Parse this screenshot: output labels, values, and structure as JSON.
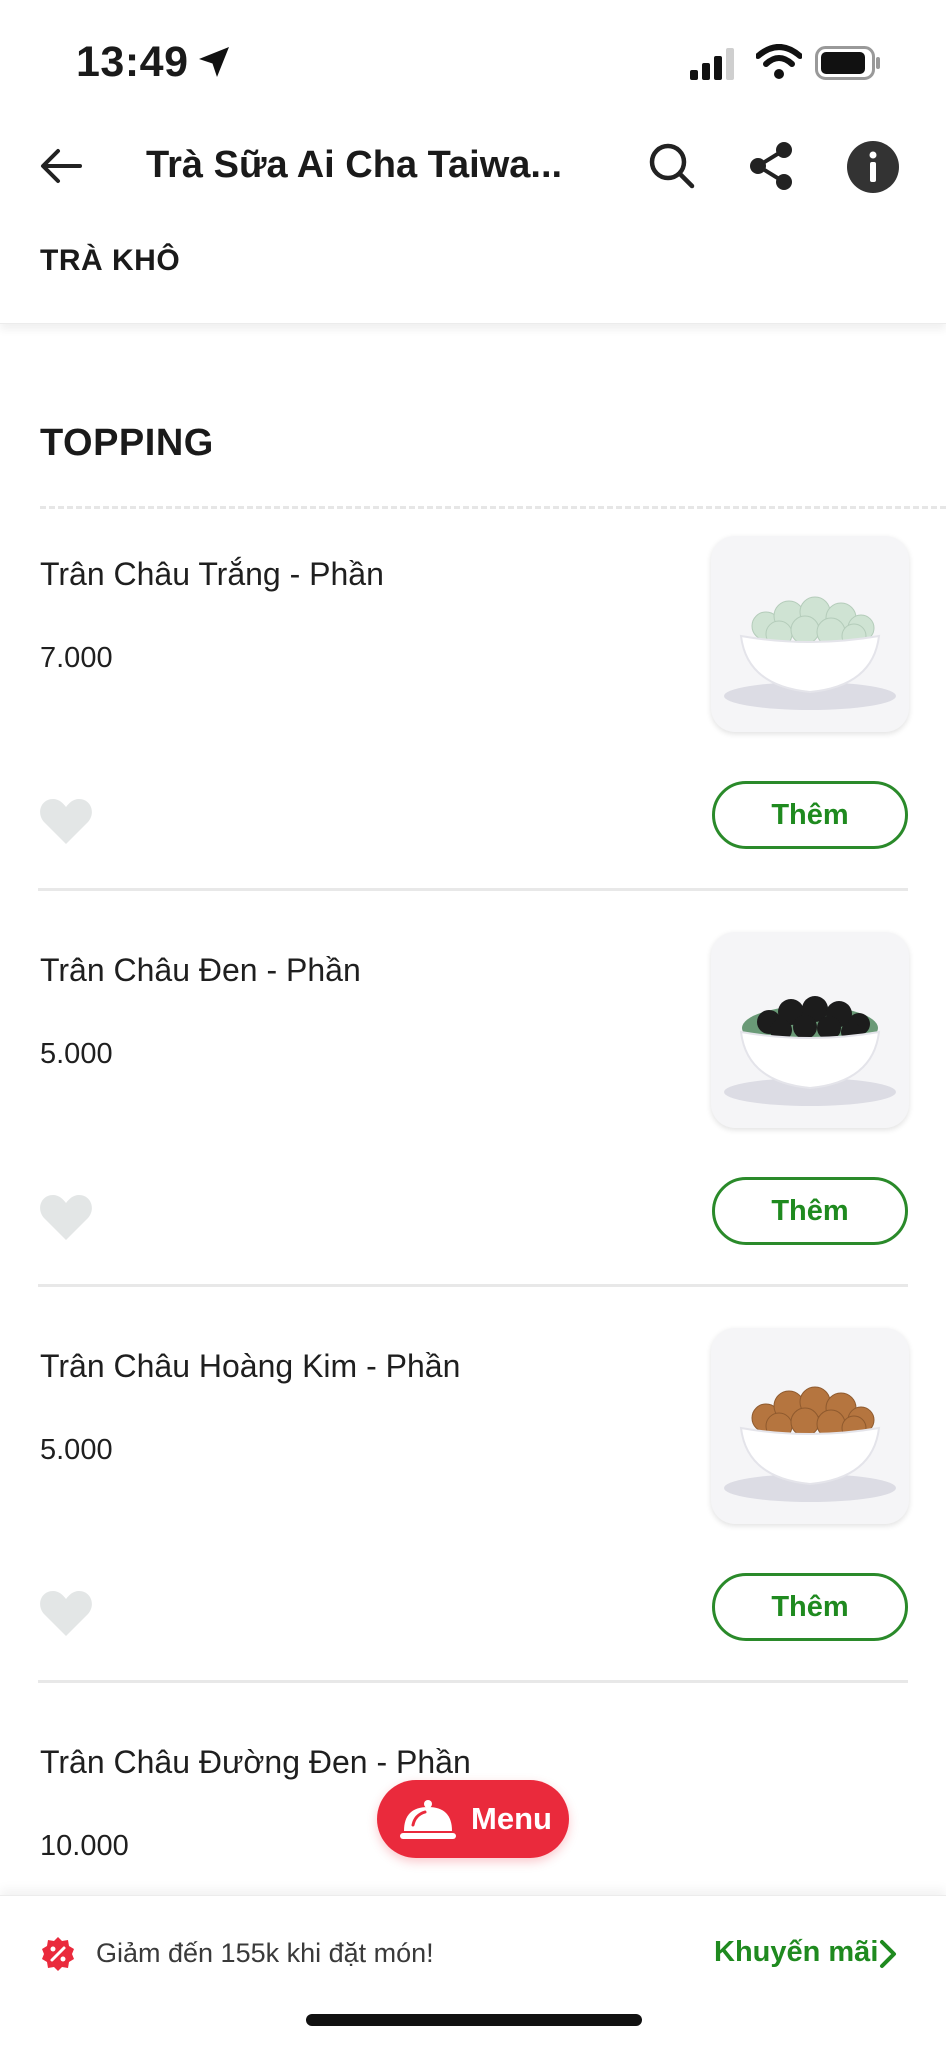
{
  "status_bar": {
    "time": "13:49"
  },
  "header": {
    "title": "Trà Sữa Ai Cha Taiwa...",
    "category_tab": "TRÀ KHÔ"
  },
  "section": {
    "title": "TOPPING"
  },
  "items": [
    {
      "name": "Trân Châu Trắng - Phần",
      "price": "7.000",
      "add_label": "Thêm",
      "pearl_color": "#cfe3d3"
    },
    {
      "name": "Trân Châu Đen - Phần",
      "price": "5.000",
      "add_label": "Thêm",
      "pearl_color": "#1c1c1c"
    },
    {
      "name": "Trân Châu Hoàng Kim - Phần",
      "price": "5.000",
      "add_label": "Thêm",
      "pearl_color": "#b5753f"
    },
    {
      "name": "Trân Châu Đường Đen - Phần",
      "price": "10.000"
    }
  ],
  "menu_button": {
    "label": "Menu"
  },
  "promo": {
    "text": "Giảm đến 155k khi đặt món!",
    "link": "Khuyến mãi"
  },
  "colors": {
    "accent_green": "#1f8a1f",
    "brand_red": "#ea2a3c"
  }
}
